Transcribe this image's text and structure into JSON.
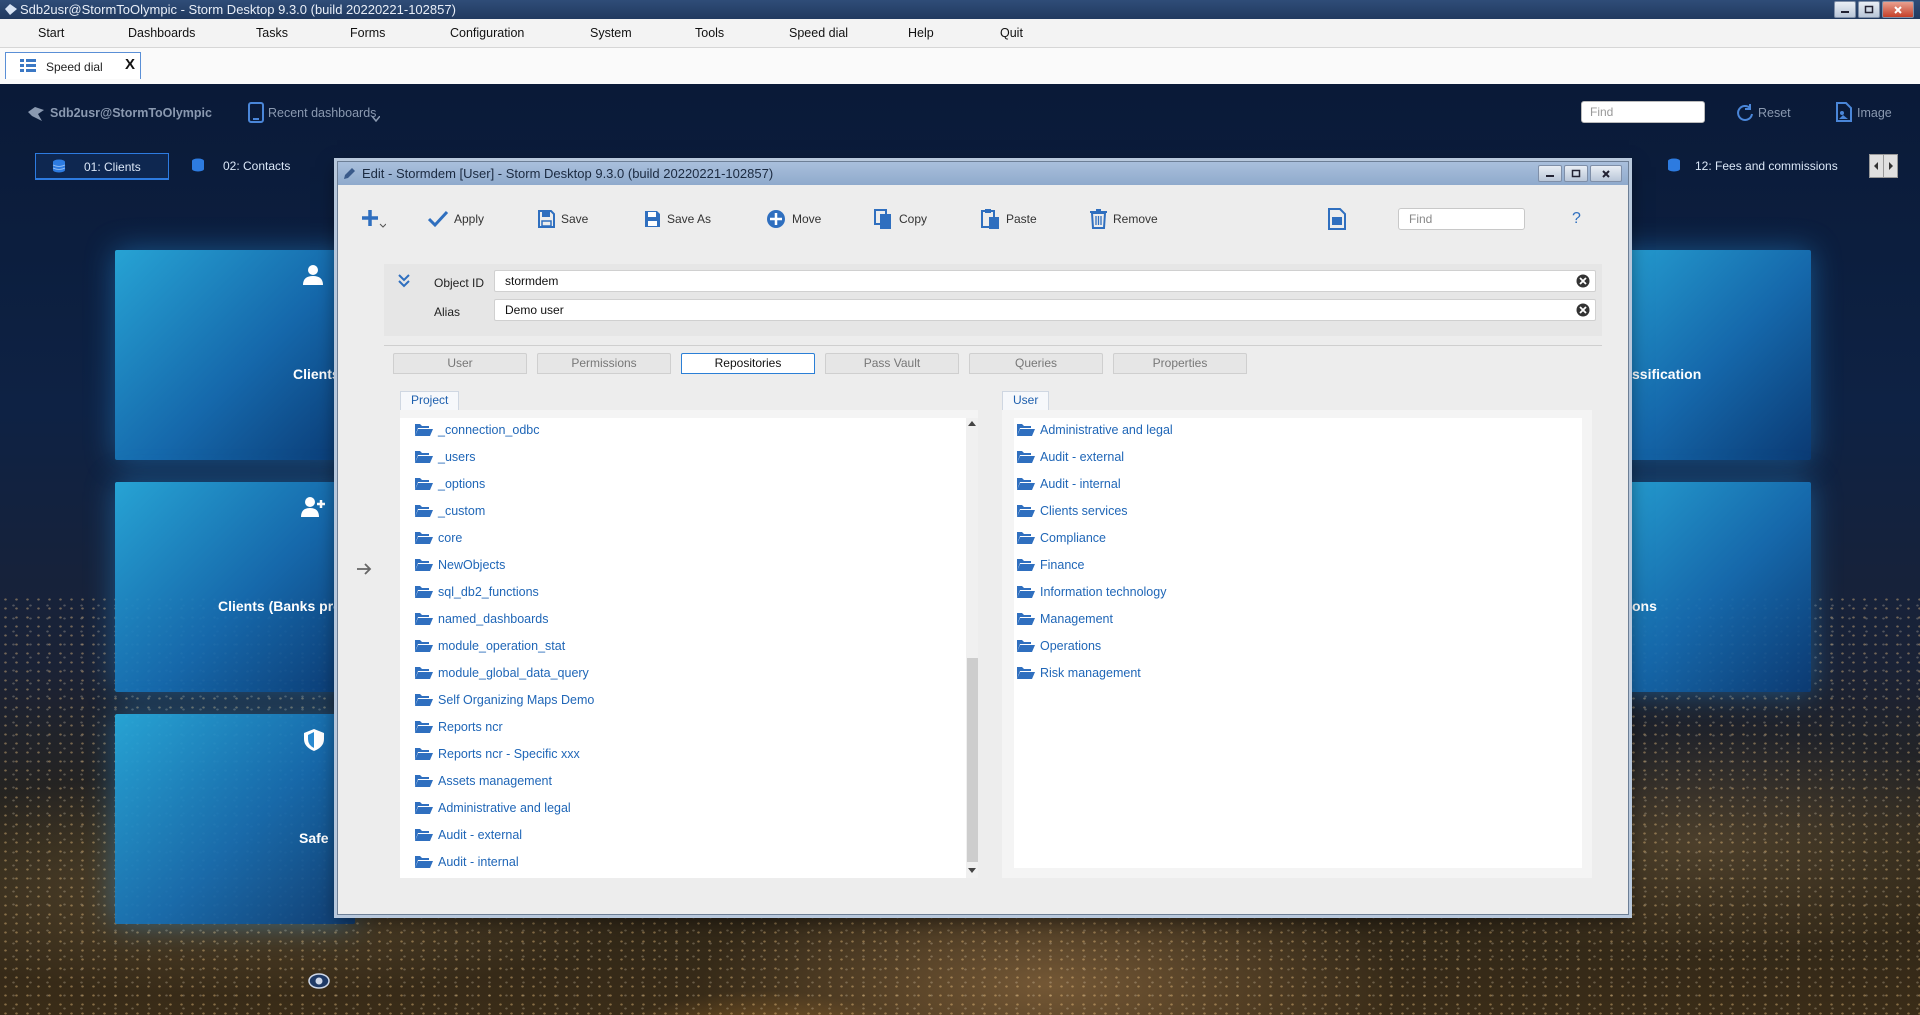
{
  "window": {
    "title": "Sdb2usr@StormToOlympic - Storm Desktop 9.3.0 (build 20220221-102857)"
  },
  "menu": [
    "Start",
    "Dashboards",
    "Tasks",
    "Forms",
    "Configuration",
    "System",
    "Tools",
    "Speed dial",
    "Help",
    "Quit"
  ],
  "speed_dial_tab": {
    "label": "Speed dial",
    "close": "X"
  },
  "dashboard": {
    "user": "Sdb2usr@StormToOlympic",
    "recent": "Recent dashboards",
    "find_placeholder": "Find",
    "reset": "Reset",
    "image": "Image",
    "tabs": [
      {
        "label": "01: Clients",
        "active": true
      },
      {
        "label": "02: Contacts",
        "active": false
      },
      {
        "label": "12: Fees and commissions",
        "active": false
      }
    ],
    "tiles": [
      {
        "label": "Clients",
        "icon": "user-icon"
      },
      {
        "label": "Clients (Banks pro",
        "icon": "add-user-icon"
      },
      {
        "label": "Safe",
        "icon": "shield-icon"
      },
      {
        "label": "ssification",
        "icon": ""
      },
      {
        "label": "ons",
        "icon": ""
      }
    ]
  },
  "dialog": {
    "title": "Edit - Stormdem [User] - Storm Desktop 9.3.0 (build 20220221-102857)",
    "toolbar": {
      "apply": "Apply",
      "save": "Save",
      "save_as": "Save As",
      "move": "Move",
      "copy": "Copy",
      "paste": "Paste",
      "remove": "Remove",
      "find_placeholder": "Find",
      "help": "?"
    },
    "fields": {
      "object_id_label": "Object ID",
      "object_id_value": "stormdem",
      "alias_label": "Alias",
      "alias_value": "Demo user"
    },
    "tabs": [
      {
        "label": "User",
        "active": false
      },
      {
        "label": "Permissions",
        "active": false
      },
      {
        "label": "Repositories",
        "active": true
      },
      {
        "label": "Pass Vault",
        "active": false
      },
      {
        "label": "Queries",
        "active": false
      },
      {
        "label": "Properties",
        "active": false
      }
    ],
    "project": {
      "header": "Project",
      "items": [
        "_connection_odbc",
        "_users",
        "_options",
        "_custom",
        "core",
        "NewObjects",
        "sql_db2_functions",
        "named_dashboards",
        "module_operation_stat",
        "module_global_data_query",
        "Self Organizing Maps Demo",
        "Reports ncr",
        "Reports ncr - Specific xxx",
        "Assets management",
        "Administrative and legal",
        "Audit - external",
        "Audit - internal"
      ]
    },
    "user_panel": {
      "header": "User",
      "items": [
        "Administrative and legal",
        "Audit - external",
        "Audit - internal",
        "Clients services",
        "Compliance",
        "Finance",
        "Information technology",
        "Management",
        "Operations",
        "Risk management"
      ]
    }
  }
}
